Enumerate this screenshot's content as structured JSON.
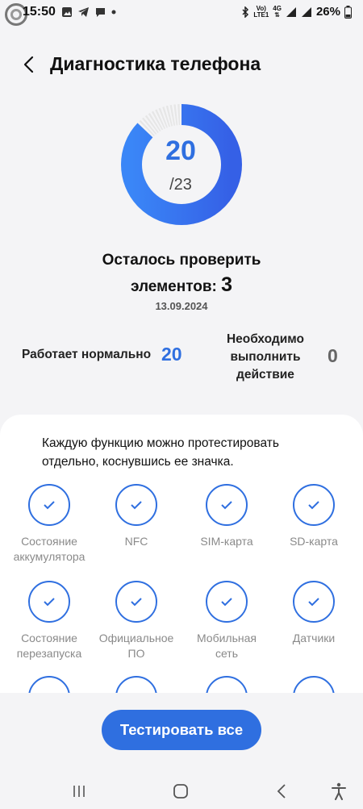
{
  "status_bar": {
    "time": "15:50",
    "network_top": "Vo)",
    "network_bottom": "LTE1",
    "net_type_top": "4G",
    "battery": "26%"
  },
  "header": {
    "title": "Диагностика телефона"
  },
  "progress": {
    "checked": "20",
    "total": "/23",
    "fraction": 0.87
  },
  "summary": {
    "remaining_line1": "Осталось проверить",
    "remaining_line2": "элементов:",
    "remaining_count": "3",
    "date": "13.09.2024"
  },
  "stats": {
    "ok_label": "Работает нормально",
    "ok_value": "20",
    "action_label_1": "Необходимо",
    "action_label_2": "выполнить",
    "action_label_3": "действие",
    "action_value": "0"
  },
  "card": {
    "hint_line1": "Каждую функцию можно протестировать",
    "hint_line2": "отдельно, коснувшись ее значка.",
    "tiles": [
      {
        "line1": "Состояние",
        "line2": "аккумулятора"
      },
      {
        "line1": "NFC",
        "line2": ""
      },
      {
        "line1": "SIM-карта",
        "line2": ""
      },
      {
        "line1": "SD-карта",
        "line2": ""
      },
      {
        "line1": "Состояние",
        "line2": "перезапуска"
      },
      {
        "line1": "Официальное",
        "line2": "ПО"
      },
      {
        "line1": "Мобильная",
        "line2": "сеть"
      },
      {
        "line1": "Датчики",
        "line2": ""
      }
    ]
  },
  "actions": {
    "test_all": "Тестировать все"
  },
  "colors": {
    "accent": "#2f6fe0",
    "background": "#f4f4f6"
  }
}
